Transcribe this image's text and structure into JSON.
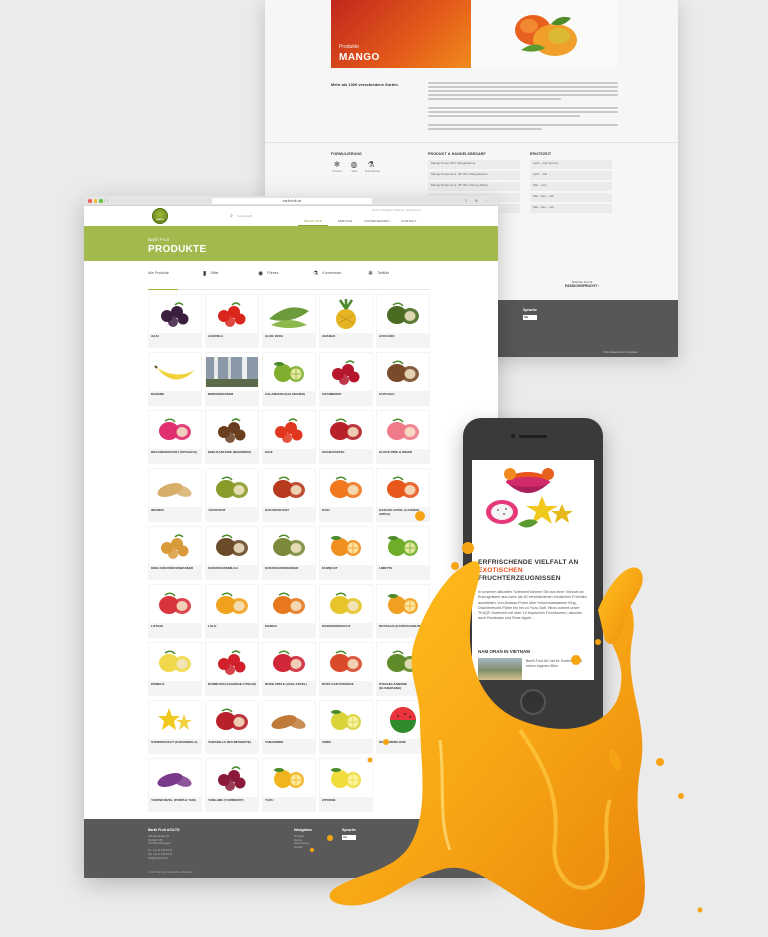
{
  "back_page": {
    "category": "Produkte",
    "title": "MANGO",
    "intro": "Mehr als 1000 verschiedene Sorten.",
    "sections": {
      "formulation": "FORMULIERUNG",
      "products": "PRODUKT & HANDELSBEDARF",
      "season": "ERNTEZEIT"
    },
    "formulation_items": [
      {
        "icon": "ice-crystal-icon",
        "label": "Frozen"
      },
      {
        "icon": "drop-icon",
        "label": "Saft"
      },
      {
        "icon": "flask-icon",
        "label": "Konzentrat"
      }
    ],
    "product_cells": [
      "Mango-Püree NFC Mangobäume",
      "Mango-Püree konz. 28° Brix Mangobäume",
      "Mango-Püree konz. 28° Brix Tommy Atkins"
    ],
    "season_cells": [
      "April – Juni (grüne)",
      "April – Juli",
      "Mai – Juni",
      "Mai / Juni – Juli",
      "Mai / Juni – Juli"
    ],
    "next_label": "Nächste Frucht",
    "next_fruit": "PASSIONSFRUCHT",
    "footer_lang": "Sprache",
    "footer_lang_value": "DE",
    "footer_links": "Home   Datenschutz   Impressum"
  },
  "browser": {
    "url": "barthfruit.de",
    "search_placeholder": "Suchbegriff",
    "top_links": "Home   Kontakt   Sitemap   Impressum",
    "nav": [
      {
        "label": "PRODUKTE",
        "active": true
      },
      {
        "label": "SERVICE",
        "active": false
      },
      {
        "label": "UNTERNEHMEN",
        "active": false
      },
      {
        "label": "KONTAKT",
        "active": false
      }
    ],
    "banner_sub": "Barth Fruit",
    "banner_title": "PRODUKTE",
    "filters": [
      {
        "icon": "all-icon",
        "label": "Alle Produkte"
      },
      {
        "icon": "juice-icon",
        "label": "Säfte"
      },
      {
        "icon": "puree-icon",
        "label": "Pürees"
      },
      {
        "icon": "concentrate-icon",
        "label": "Konzentrate"
      },
      {
        "icon": "frozen-icon",
        "label": "Tiefkühl"
      }
    ],
    "products": [
      {
        "name": "Açai",
        "color": "#3b1f3f",
        "shape": "berries"
      },
      {
        "name": "Acerola",
        "color": "#d9261c",
        "shape": "berries"
      },
      {
        "name": "Aloe Vera",
        "color": "#6d9a3a",
        "shape": "leaf"
      },
      {
        "name": "Ananas",
        "color": "#e6b422",
        "shape": "pine"
      },
      {
        "name": "Avocado",
        "color": "#4a6b22",
        "shape": "halves"
      },
      {
        "name": "Banane",
        "color": "#f2d23a",
        "shape": "banana"
      },
      {
        "name": "Birkenwasser",
        "color": "#6f7f8c",
        "shape": "photo"
      },
      {
        "name": "Calamansi (Kalamansi)",
        "color": "#7fae2f",
        "shape": "citrus"
      },
      {
        "name": "Cranberry",
        "color": "#b5162b",
        "shape": "berries"
      },
      {
        "name": "Cupuaçu",
        "color": "#7a4b2a",
        "shape": "halves"
      },
      {
        "name": "Drachenfrucht (Pitahaya)",
        "color": "#e0306f",
        "shape": "halves"
      },
      {
        "name": "Edelkastanie (Maronen)",
        "color": "#6a3d1e",
        "shape": "berries"
      },
      {
        "name": "Goji",
        "color": "#e0361e",
        "shape": "berries"
      },
      {
        "name": "Granatapfel",
        "color": "#b8202a",
        "shape": "halves"
      },
      {
        "name": "Guave Pink & Weiss",
        "color": "#f07a8a",
        "shape": "halves"
      },
      {
        "name": "Ingwer",
        "color": "#d6ae6a",
        "shape": "root"
      },
      {
        "name": "Jackfruit",
        "color": "#8a9b2a",
        "shape": "halves"
      },
      {
        "name": "Kakaofrucht",
        "color": "#b83a1e",
        "shape": "halves"
      },
      {
        "name": "Kaki",
        "color": "#f0781e",
        "shape": "halves"
      },
      {
        "name": "Kaschu-Apfel (Cashew Apple)",
        "color": "#e8581c",
        "shape": "halves"
      },
      {
        "name": "King Kokosnusswasser",
        "color": "#d99a3a",
        "shape": "berries"
      },
      {
        "name": "Kokosnussmilch",
        "color": "#6b4a2a",
        "shape": "halves"
      },
      {
        "name": "Kokosnusswasser",
        "color": "#7a8a3a",
        "shape": "halves"
      },
      {
        "name": "Kumquat",
        "color": "#f0901e",
        "shape": "citrus"
      },
      {
        "name": "Limette",
        "color": "#6fae2a",
        "shape": "citrus"
      },
      {
        "name": "Litschi",
        "color": "#d8343c",
        "shape": "halves"
      },
      {
        "name": "Lulo",
        "color": "#f0a21e",
        "shape": "halves"
      },
      {
        "name": "Mango",
        "color": "#e8781e",
        "shape": "halves"
      },
      {
        "name": "Passionsfrucht",
        "color": "#e6c42a",
        "shape": "halves"
      },
      {
        "name": "Physalis (Kapstachelbeere)",
        "color": "#f0a020",
        "shape": "citrus"
      },
      {
        "name": "Pomelo",
        "color": "#f0d84a",
        "shape": "halves"
      },
      {
        "name": "Rambutan (Haarige Litschi)",
        "color": "#d0202a",
        "shape": "berries"
      },
      {
        "name": "Rose Apple (Java-Apfel)",
        "color": "#d02838",
        "shape": "halves"
      },
      {
        "name": "Rote Kaktusfeige",
        "color": "#d84a2a",
        "shape": "halves"
      },
      {
        "name": "Stachelannone (Guanabana)",
        "color": "#5f8a2a",
        "shape": "halves"
      },
      {
        "name": "Sternfrucht (Karambola)",
        "color": "#f0c81e",
        "shape": "star"
      },
      {
        "name": "Tamarillo (Baumtomate)",
        "color": "#b8202a",
        "shape": "halves"
      },
      {
        "name": "Tamarinde",
        "color": "#c07a3a",
        "shape": "root"
      },
      {
        "name": "Umbu",
        "color": "#d8d43a",
        "shape": "citrus"
      },
      {
        "name": "Wassermelone",
        "color": "#2e8a2a",
        "shape": "melon"
      },
      {
        "name": "Yamswurzel (Purple Yam)",
        "color": "#7a3a8a",
        "shape": "root"
      },
      {
        "name": "Yang-Mei (Yumberry)",
        "color": "#8a1a3a",
        "shape": "berries"
      },
      {
        "name": "Yuzu",
        "color": "#f0b41e",
        "shape": "citrus"
      },
      {
        "name": "Zitrone",
        "color": "#f0dc3a",
        "shape": "citrus"
      }
    ],
    "footer": {
      "company": "Barth Fruit AG/LTD",
      "address": "Industriestrasse 8a\nPostfach 145\nCH-3110 Münsingen\n\nTel. +41 31 720 64 00\nFax +41 31 720 64 01\ninfo@barthfruit.ch",
      "nav_title": "Navigation",
      "nav_links": "Produkte\nService\nUnternehmen\nKontakt",
      "lang_title": "Sprache",
      "lang_value": "DE",
      "copyright": "© 2017 Barth Fruit. Alle Rechte vorbehalten."
    }
  },
  "phone": {
    "headline_1": "ERFRISCHENDE VIELFALT AN",
    "headline_highlight": "EXOTISCHEN",
    "headline_2": "FRUCHTERZEUGNISSEN",
    "body": "In unserem aktuellen Sortiment können Sie aus einer Vielzahl an Erzeugnissen aus mehr als 40 verschiedenen exotischen Früchten auswählen: von Ananas-Püree über Kokosnusswasser King, Drachenfrucht-Püree bis hin zu Yuzu-Saft. Hinzu kommt unser TKAQF-Sortiment mit über 10 tropischen Fruchtsorten, darunter auch Rambutan und Rose Apple.",
    "sub": "NAM ORAN IN VIETNAM",
    "news": "Barth Fruit AG hat ihr Sortiment mit einem eigenen Büro"
  },
  "colors": {
    "brand_green": "#a2b94d",
    "accent_orange": "#e8541c",
    "footer_gray": "#595959"
  }
}
